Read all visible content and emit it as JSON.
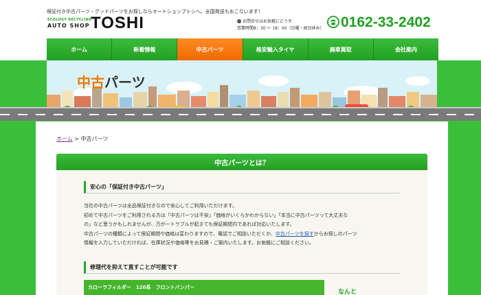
{
  "header": {
    "tagline": "保証付き中古パーツ・グッドパーツをお探しならオートショップトシへ。全国発送もおこないます！",
    "logo_small": "ECOLOGY RECYCLING",
    "logo_auto": "AUTO SHOP",
    "logo_name": "TOSHI",
    "contact_line1": "お問合せはお気軽にどうぞ",
    "contact_line2": "営業時間8：30 ～ 18：00（日曜・祝日休み）",
    "phone": "0162-33-2402"
  },
  "nav": {
    "items": [
      {
        "label": "ホーム"
      },
      {
        "label": "新着情報"
      },
      {
        "label": "中古パーツ"
      },
      {
        "label": "格安輸入タイヤ"
      },
      {
        "label": "廃車買取"
      },
      {
        "label": "会社案内"
      }
    ],
    "active_index": 2
  },
  "hero": {
    "title_orange": "中古",
    "title_rest": "パーツ"
  },
  "breadcrumb": {
    "home": "ホーム",
    "separator": " > ",
    "current": "中古パーツ"
  },
  "section": {
    "heading": "中古パーツとは？",
    "subtitle1": "安心の「保証付き中古パーツ」",
    "para_line1": "当社の中古パーツは全品保証付きなので安心してご利用いただけます。",
    "para_line2": "初めて中古パーツをご利用される方は「中古パーツは不安」「価格がいくらかわからない」「本当に中古パーツって大丈夫な",
    "para_line3": "の」など思うかもしれませんが、万が一トラブルが起きても保証期間内であれば対応いたします。",
    "para_line4a": "中古パーツの種類によって保証期間や価格は変わりますので、電話でご相談いただくか、",
    "para_link": "中古パーツを探す",
    "para_line4b": "からお探しのパーツ",
    "para_line5": "情報を入力していただければ、在庫状況や価格等をお見積・ご案内いたします。お気軽にご相談ください。",
    "subtitle2": "修理代を抑えて直すことが可能です",
    "product_bar": "カローラフィルダー　120系　フロントバンパー",
    "side_text": "なんと"
  },
  "colors": {
    "brand_green": "#22a022",
    "active_orange": "#f06a00",
    "band_green": "#3bbf3b"
  }
}
